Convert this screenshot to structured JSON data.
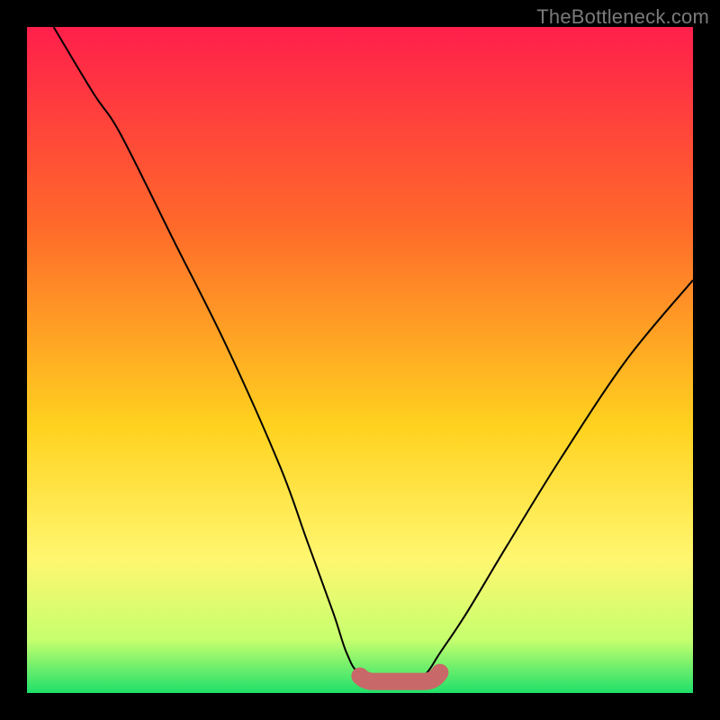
{
  "watermark": "TheBottleneck.com",
  "colors": {
    "frame": "#000000",
    "grad_top": "#ff1f4b",
    "grad_mid1": "#ff6a2a",
    "grad_mid2": "#ffd21f",
    "grad_mid3": "#fff770",
    "grad_mid4": "#c6ff6e",
    "grad_bottom": "#1fe06a",
    "curve": "#000000",
    "bar": "#c96868"
  },
  "chart_data": {
    "type": "line",
    "title": "",
    "xlabel": "",
    "ylabel": "",
    "xlim": [
      0,
      100
    ],
    "ylim": [
      0,
      100
    ],
    "x": [
      4,
      10,
      14,
      22,
      30,
      38,
      42,
      46,
      48,
      50,
      55,
      58,
      60,
      62,
      66,
      72,
      80,
      90,
      100
    ],
    "values": [
      100,
      90,
      84,
      68,
      52,
      34,
      23,
      12,
      6,
      3,
      2,
      2,
      3,
      6,
      12,
      22,
      35,
      50,
      62
    ],
    "annotations": {
      "bottom_bar": {
        "x_start": 50,
        "x_end": 62,
        "y": 2,
        "thickness": 2.6
      }
    }
  }
}
